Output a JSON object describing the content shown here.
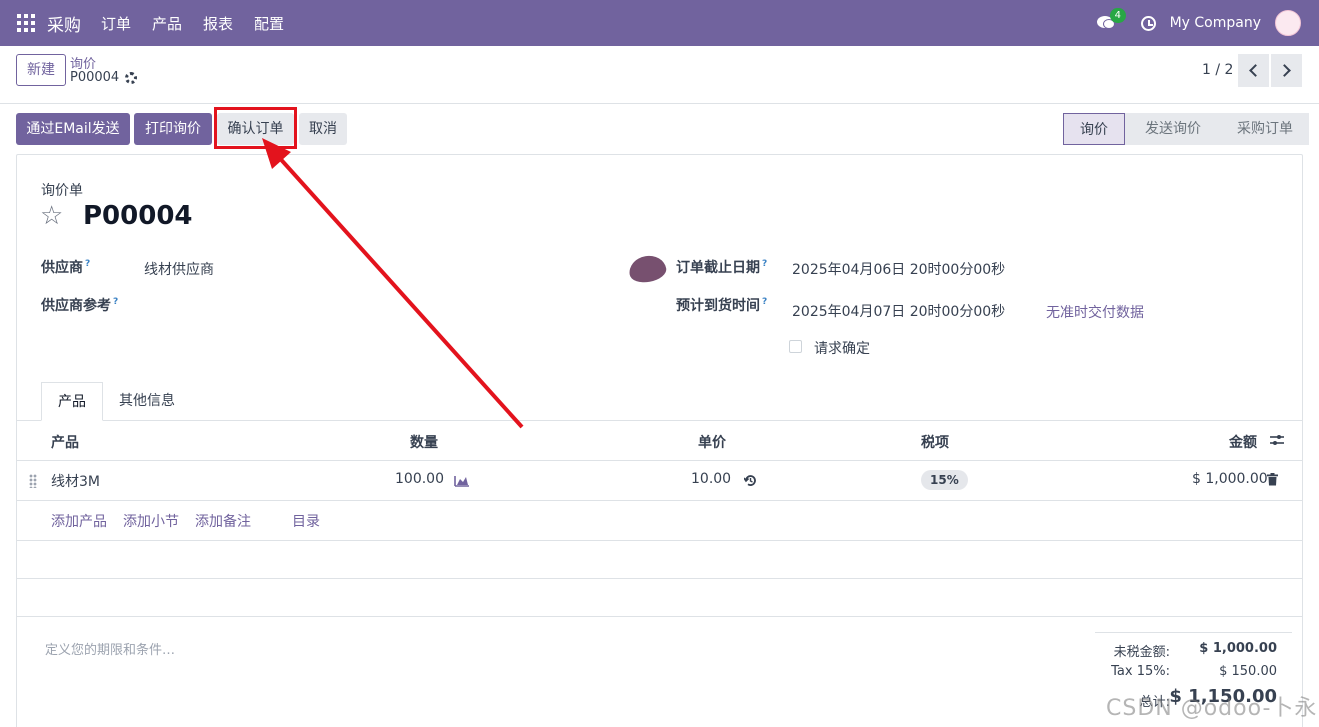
{
  "navbar": {
    "brand": "采购",
    "menu": [
      "订单",
      "产品",
      "报表",
      "配置"
    ],
    "chat_count": "4",
    "company": "My Company"
  },
  "control_panel": {
    "new_button": "新建",
    "breadcrumb_parent": "询价",
    "breadcrumb_current": "P00004",
    "pager": "1 / 2"
  },
  "actions": {
    "send_email": "通过EMail发送",
    "print_rfq": "打印询价",
    "confirm_order": "确认订单",
    "cancel": "取消"
  },
  "statusbar": {
    "steps": [
      "询价",
      "发送询价",
      "采购订单"
    ],
    "active": "询价"
  },
  "form": {
    "doc_type": "询价单",
    "name": "P00004",
    "vendor_label": "供应商",
    "vendor_value": "线材供应商",
    "vendor_ref_label": "供应商参考",
    "deadline_label": "订单截止日期",
    "deadline_value": "2025年04月06日 20时00分00秒",
    "expected_label": "预计到货时间",
    "expected_value": "2025年04月07日 20时00分00秒",
    "ontime_link": "无准时交付数据",
    "confirm_request_label": "请求确定",
    "help_mark": "?"
  },
  "tabs": [
    "产品",
    "其他信息"
  ],
  "table": {
    "headers": [
      "产品",
      "数量",
      "单价",
      "税项",
      "金额"
    ],
    "rows": [
      {
        "product": "线材3M",
        "qty": "100.00",
        "price": "10.00",
        "tax": "15%",
        "amount": "$ 1,000.00"
      }
    ],
    "add_links": [
      "添加产品",
      "添加小节",
      "添加备注",
      "目录"
    ]
  },
  "terms_placeholder": "定义您的期限和条件…",
  "totals": {
    "untaxed_label": "未税金额:",
    "untaxed_value": "$ 1,000.00",
    "tax_label": "Tax 15%:",
    "tax_value": "$ 150.00",
    "total_label": "总计:",
    "total_value": "$ 1,150.00"
  },
  "watermark": "CSDN @odoo-卜永",
  "colors": {
    "brand": "#71639e",
    "highlight": "#e3131d",
    "badge": "#28a745"
  }
}
